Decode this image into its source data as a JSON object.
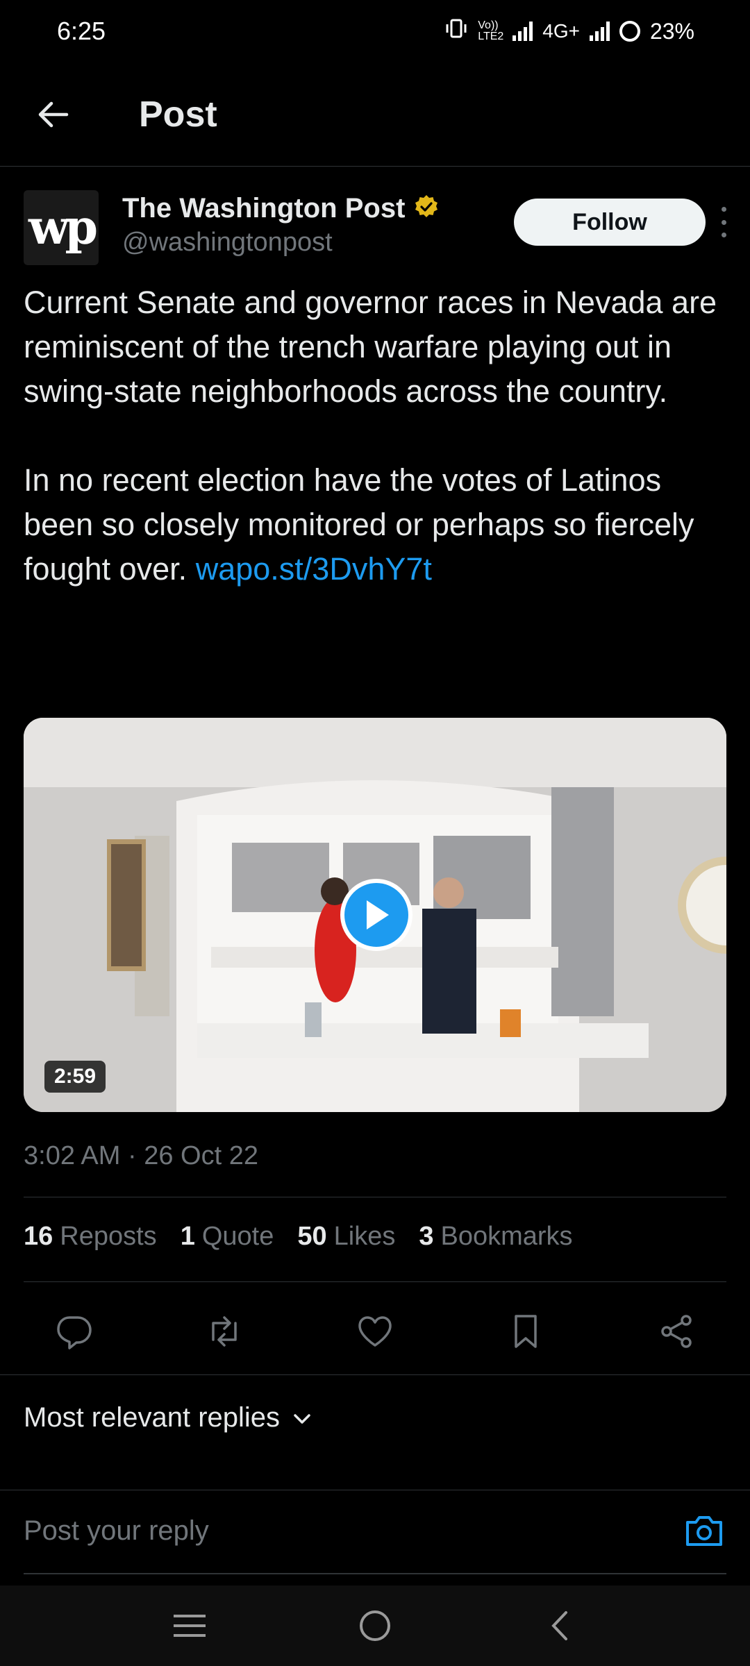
{
  "status_bar": {
    "time": "6:25",
    "network_label": "4G+",
    "volte_label": "Vo)) LTE2",
    "battery": "23%"
  },
  "header": {
    "title": "Post"
  },
  "post": {
    "author_name": "The Washington Post",
    "author_handle": "@washingtonpost",
    "avatar_text": "wp",
    "verified_color": "#e2b719",
    "follow_label": "Follow",
    "text_paragraph_1": "Current Senate and governor races in Nevada are reminiscent of the trench warfare playing out in swing-state neighborhoods across the country.",
    "text_paragraph_2": "In no recent election have the votes of Latinos been so closely monitored or perhaps so fiercely fought over.",
    "link_text": "wapo.st/​3DvhY7t",
    "video_duration": "2:59",
    "timestamp": "3:02 AM · 26 Oct 22"
  },
  "stats": [
    {
      "count": "16",
      "label": "Reposts"
    },
    {
      "count": "1",
      "label": "Quote"
    },
    {
      "count": "50",
      "label": "Likes"
    },
    {
      "count": "3",
      "label": "Bookmarks"
    }
  ],
  "actions": [
    "reply-icon",
    "repost-icon",
    "like-icon",
    "bookmark-icon",
    "share-icon"
  ],
  "replies": {
    "sort_label": "Most relevant replies"
  },
  "reply_bar": {
    "placeholder": "Post your reply"
  },
  "colors": {
    "accent": "#1d9bf0",
    "background": "#000000",
    "muted": "#71767b"
  }
}
